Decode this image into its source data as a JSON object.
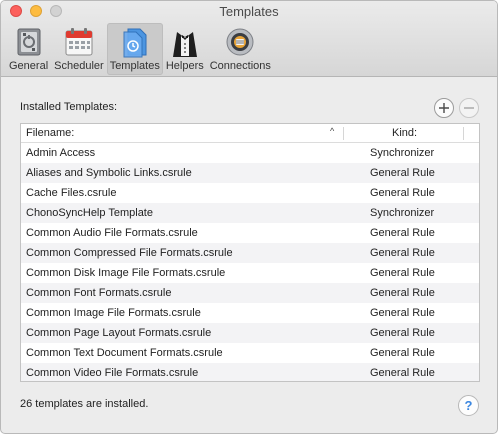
{
  "window": {
    "title": "Templates"
  },
  "toolbar": {
    "items": [
      {
        "label": "General",
        "icon": "general-switch-icon"
      },
      {
        "label": "Scheduler",
        "icon": "calendar-icon"
      },
      {
        "label": "Templates",
        "icon": "templates-document-icon",
        "selected": true
      },
      {
        "label": "Helpers",
        "icon": "butler-icon"
      },
      {
        "label": "Connections",
        "icon": "connections-globe-icon"
      }
    ]
  },
  "installed": {
    "label": "Installed Templates:",
    "add_icon": "plus-icon",
    "remove_icon": "minus-icon"
  },
  "table": {
    "columns": {
      "filename": "Filename:",
      "kind": "Kind:"
    },
    "sort_indicator": "^",
    "rows": [
      {
        "filename": "Admin Access",
        "kind": "Synchronizer"
      },
      {
        "filename": "Aliases and Symbolic Links.csrule",
        "kind": "General Rule"
      },
      {
        "filename": "Cache Files.csrule",
        "kind": "General Rule"
      },
      {
        "filename": "ChonoSyncHelp Template",
        "kind": "Synchronizer"
      },
      {
        "filename": "Common Audio File Formats.csrule",
        "kind": "General Rule"
      },
      {
        "filename": "Common Compressed File Formats.csrule",
        "kind": "General Rule"
      },
      {
        "filename": "Common Disk Image File Formats.csrule",
        "kind": "General Rule"
      },
      {
        "filename": "Common Font Formats.csrule",
        "kind": "General Rule"
      },
      {
        "filename": "Common Image File Formats.csrule",
        "kind": "General Rule"
      },
      {
        "filename": "Common Page Layout Formats.csrule",
        "kind": "General Rule"
      },
      {
        "filename": "Common Text Document Formats.csrule",
        "kind": "General Rule"
      },
      {
        "filename": "Common Video File Formats.csrule",
        "kind": "General Rule"
      }
    ]
  },
  "status": {
    "text": "26 templates are installed."
  },
  "help": {
    "label": "?"
  }
}
